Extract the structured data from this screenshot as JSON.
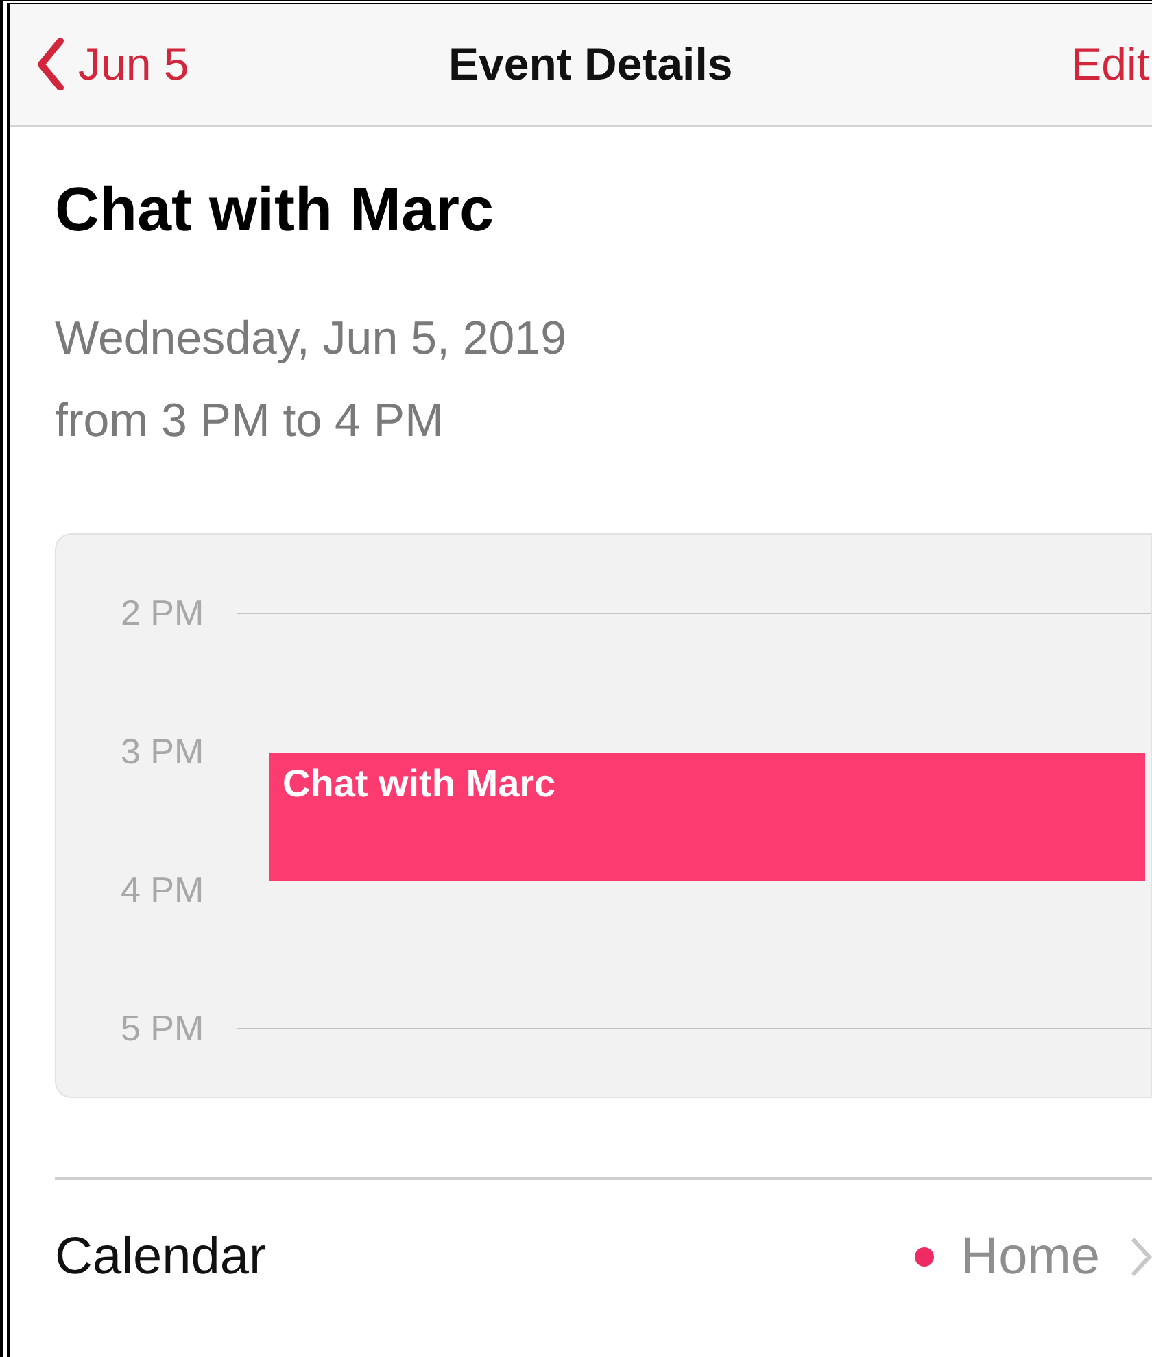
{
  "nav": {
    "back": "Jun 5",
    "title": "Event Details",
    "action": "Edit"
  },
  "event": {
    "title": "Chat with Marc",
    "date": "Wednesday, Jun 5, 2019",
    "time": "from 3 PM to 4 PM"
  },
  "timeline": {
    "hours": [
      {
        "label": "2 PM"
      },
      {
        "label": "3 PM",
        "event": {
          "title": "Chat with Marc",
          "color": "#fc3b70"
        }
      },
      {
        "label": "4 PM"
      },
      {
        "label": "5 PM"
      }
    ]
  },
  "calendar_row": {
    "label": "Calendar",
    "value": "Home",
    "color": "#ee2b62"
  }
}
